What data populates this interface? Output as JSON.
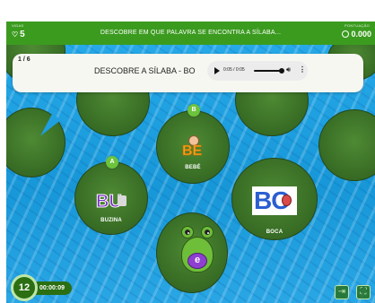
{
  "header": {
    "lives_label": "VIDAS",
    "lives": "5",
    "title": "DESCOBRE EM QUE PALAVRA SE ENCONTRA A SÍLABA...",
    "score_label": "PONTUAÇÃO",
    "score": "0.000"
  },
  "question": {
    "counter": "1 / 6",
    "text": "DESCOBRE A SÍLABA - BO",
    "audio": {
      "time": "0:05 / 0:05",
      "progress": 1.0
    }
  },
  "options": [
    {
      "letter": "A",
      "word": "BUZINA",
      "picture_text": "BU"
    },
    {
      "letter": "B",
      "word": "BEBÉ",
      "picture_text": "BE"
    },
    {
      "letter": "",
      "word": "BOCA",
      "picture_text": "BO"
    }
  ],
  "player": {
    "belly_letter": "e"
  },
  "status": {
    "countdown": "12",
    "elapsed": "00:00:09"
  },
  "icons": [
    "heart-icon",
    "coin-icon",
    "play-icon",
    "volume-icon",
    "more-icon",
    "exit-icon",
    "fullscreen-icon"
  ],
  "colors": {
    "topbar": "#3b9b1f",
    "water": "#1e9fe0",
    "lily_pad": "#3a6f26",
    "badge": "#6cc43d"
  }
}
